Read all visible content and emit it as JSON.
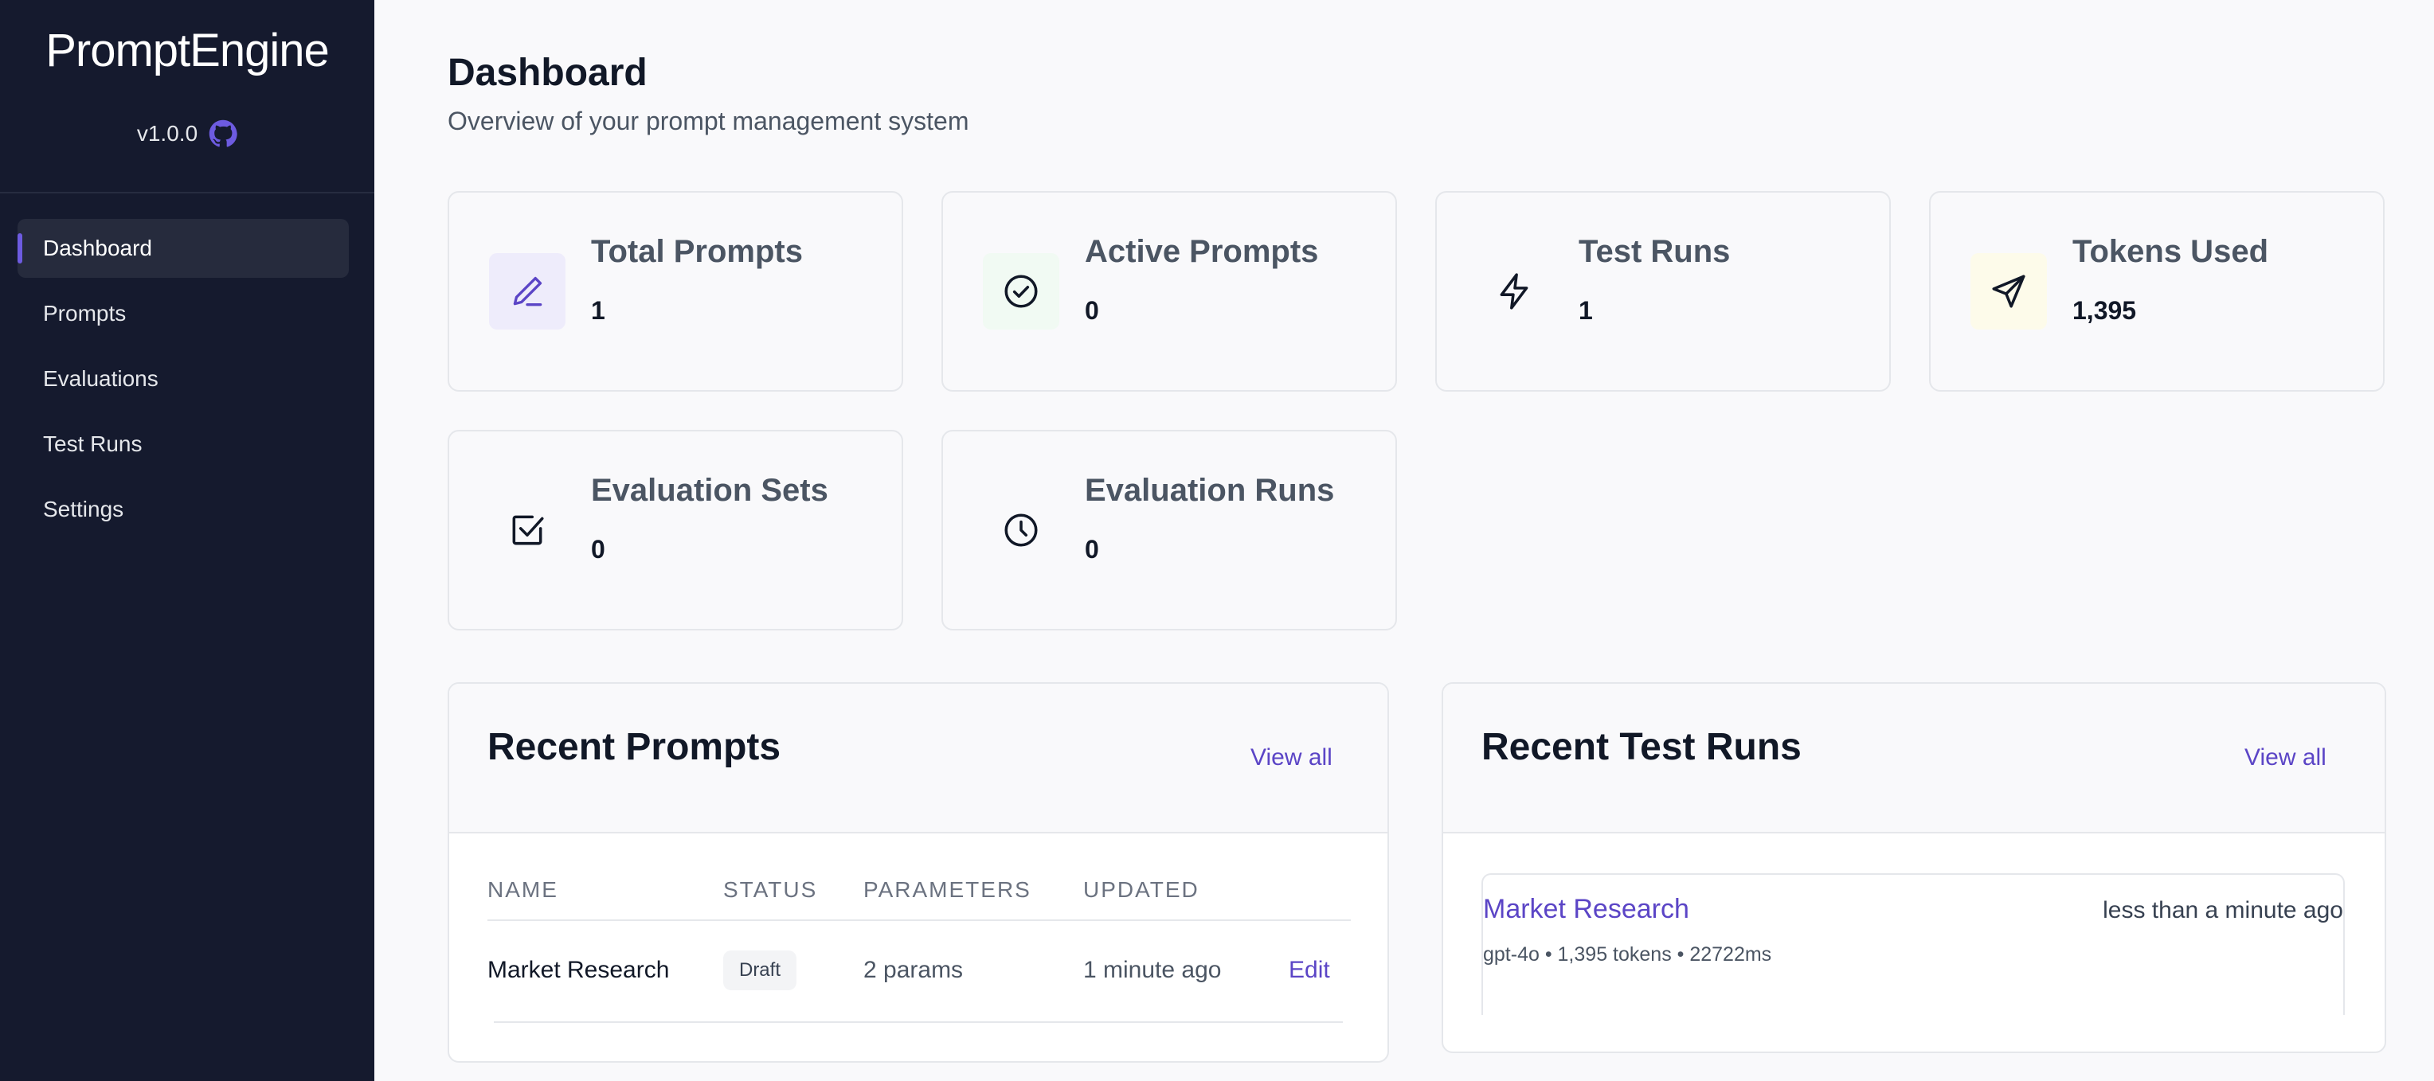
{
  "sidebar": {
    "brand": "PromptEngine",
    "version": "v1.0.0",
    "github_icon": "github-icon",
    "nav": [
      {
        "label": "Dashboard",
        "active": true
      },
      {
        "label": "Prompts",
        "active": false
      },
      {
        "label": "Evaluations",
        "active": false
      },
      {
        "label": "Test Runs",
        "active": false
      },
      {
        "label": "Settings",
        "active": false
      }
    ]
  },
  "header": {
    "title": "Dashboard",
    "subtitle": "Overview of your prompt management system"
  },
  "stats": [
    {
      "label": "Total Prompts",
      "value": "1",
      "icon": "pencil-icon",
      "icon_bg": "#eeecfb",
      "icon_color": "#5b45c6"
    },
    {
      "label": "Active Prompts",
      "value": "0",
      "icon": "check-circle-icon",
      "icon_bg": "#f1faf3",
      "icon_color": "#111827"
    },
    {
      "label": "Test Runs",
      "value": "1",
      "icon": "lightning-icon",
      "icon_bg": "#f9f9fb",
      "icon_color": "#111827"
    },
    {
      "label": "Tokens Used",
      "value": "1,395",
      "icon": "send-icon",
      "icon_bg": "#fdfbea",
      "icon_color": "#111827"
    },
    {
      "label": "Evaluation Sets",
      "value": "0",
      "icon": "checkbox-icon",
      "icon_bg": "#f9f9fb",
      "icon_color": "#111827"
    },
    {
      "label": "Evaluation Runs",
      "value": "0",
      "icon": "clock-icon",
      "icon_bg": "#f9f9fb",
      "icon_color": "#111827"
    }
  ],
  "recent_prompts": {
    "title": "Recent Prompts",
    "view_all": "View all",
    "columns": [
      "Name",
      "Status",
      "Parameters",
      "Updated"
    ],
    "rows": [
      {
        "name": "Market Research",
        "status": "Draft",
        "parameters": "2 params",
        "updated": "1 minute ago",
        "action": "Edit"
      }
    ]
  },
  "recent_test_runs": {
    "title": "Recent Test Runs",
    "view_all": "View all",
    "items": [
      {
        "name": "Market Research",
        "time": "less than a minute ago",
        "meta": "gpt-4o • 1,395 tokens • 22722ms"
      }
    ]
  },
  "colors": {
    "accent": "#5b45c6",
    "sidebar_bg": "#151a2e"
  }
}
